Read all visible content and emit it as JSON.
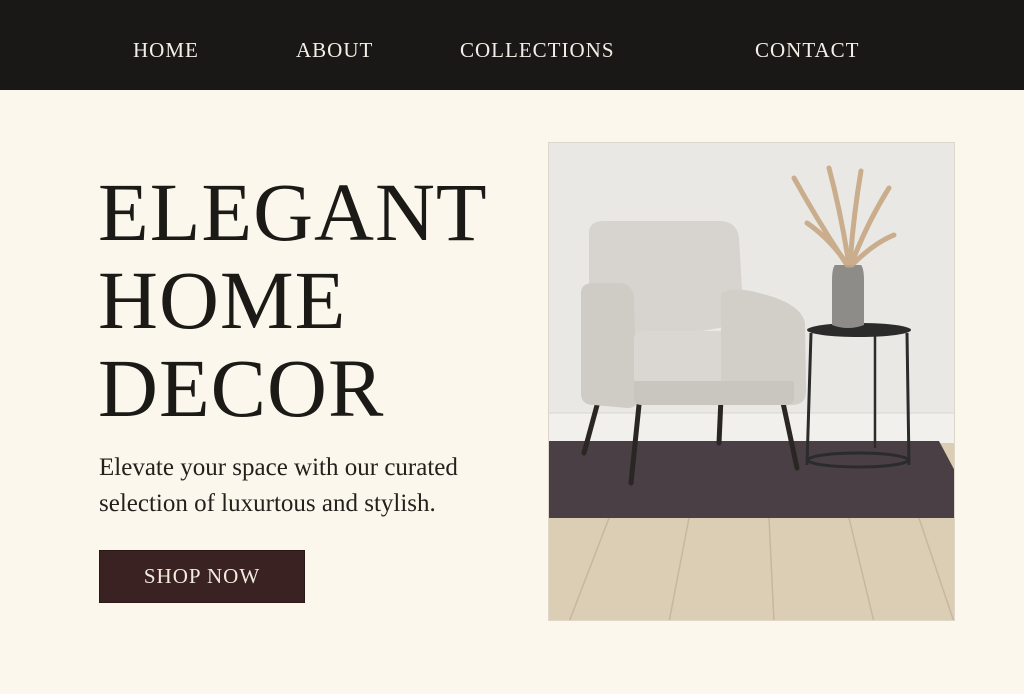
{
  "nav": {
    "items": [
      {
        "label": "HOME"
      },
      {
        "label": "ABOUT"
      },
      {
        "label": "COLLECTIONS"
      },
      {
        "label": "CONTACT"
      }
    ]
  },
  "hero": {
    "title_lines": [
      "ELEGANT",
      "HOME",
      "DECOR"
    ],
    "subtitle": "Elevate your space with our curated selection of luxurtous and stylish.",
    "cta_label": "SHOP NOW"
  },
  "colors": {
    "page_background": "#fcf7ec",
    "nav_background": "#1a1816",
    "button_background": "#3b2222",
    "text_dark": "#1e1b17"
  },
  "image": {
    "icon": "armchair-photo"
  }
}
